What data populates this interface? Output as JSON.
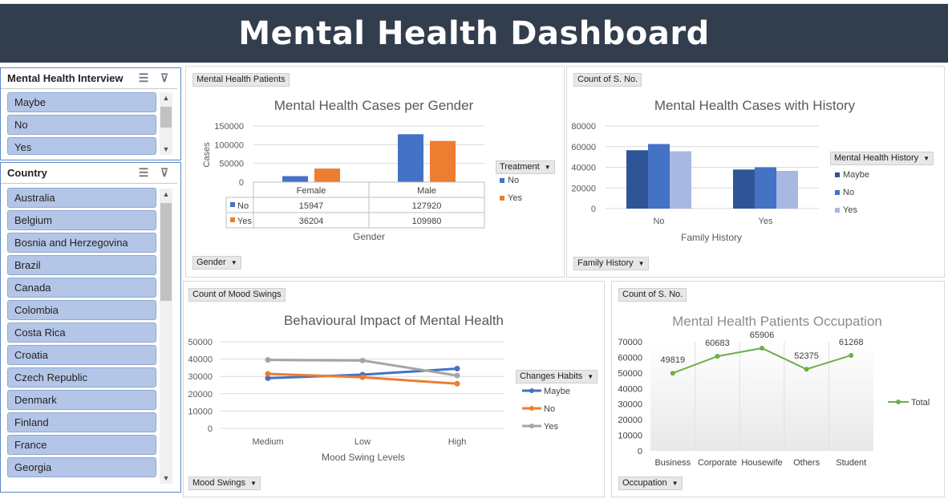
{
  "dashboard_title": "Mental Health Dashboard",
  "slicers": {
    "interview": {
      "title": "Mental Health Interview",
      "items": [
        "Maybe",
        "No",
        "Yes"
      ]
    },
    "country": {
      "title": "Country",
      "items": [
        "Australia",
        "Belgium",
        "Bosnia and Herzegovina",
        "Brazil",
        "Canada",
        "Colombia",
        "Costa Rica",
        "Croatia",
        "Czech Republic",
        "Denmark",
        "Finland",
        "France",
        "Georgia"
      ]
    }
  },
  "colors": {
    "blue": "#4472c4",
    "orange": "#ed7d31",
    "gray": "#a5a5a5",
    "green": "#70ad47",
    "dark_blue": "#2f5597",
    "light_blue": "#a9b8e0",
    "banner": "#323d4d"
  },
  "panels": {
    "gender": {
      "value_btn": "Mental Health Patients",
      "axis_btn": "Gender",
      "legend_btn": "Treatment"
    },
    "history": {
      "value_btn": "Count of S. No.",
      "axis_btn": "Family History",
      "legend_btn": "Mental Health History"
    },
    "mood": {
      "value_btn": "Count of Mood Swings",
      "axis_btn": "Mood Swings",
      "legend_btn": "Changes Habits"
    },
    "occupation": {
      "value_btn": "Count of S. No.",
      "axis_btn": "Occupation"
    }
  },
  "chart_data": [
    {
      "type": "bar",
      "title": "Mental Health Cases per Gender",
      "xlabel": "Gender",
      "ylabel": "Cases",
      "categories": [
        "Female",
        "Male"
      ],
      "series": [
        {
          "name": "No",
          "values": [
            15947,
            127920
          ]
        },
        {
          "name": "Yes",
          "values": [
            36204,
            109980
          ]
        }
      ],
      "ylim": [
        0,
        150000
      ],
      "yticks": [
        "150000",
        "100000",
        "50000",
        "0"
      ],
      "table": [
        [
          "15947",
          "127920"
        ],
        [
          "36204",
          "109980"
        ]
      ],
      "legend_position": "right"
    },
    {
      "type": "bar",
      "title": "Mental Health Cases with History",
      "xlabel": "Family History",
      "categories": [
        "No",
        "Yes"
      ],
      "series": [
        {
          "name": "Maybe",
          "values": [
            56500,
            37800
          ]
        },
        {
          "name": "No",
          "values": [
            62500,
            40000
          ]
        },
        {
          "name": "Yes",
          "values": [
            55500,
            36500
          ]
        }
      ],
      "ylim": [
        0,
        80000
      ],
      "yticks": [
        "80000",
        "60000",
        "40000",
        "20000",
        "0"
      ],
      "legend_position": "right"
    },
    {
      "type": "line",
      "title": "Behavioural Impact of Mental Health",
      "xlabel": "Mood Swing Levels",
      "categories": [
        "Medium",
        "Low",
        "High"
      ],
      "series": [
        {
          "name": "Maybe",
          "values": [
            29000,
            31000,
            34500
          ]
        },
        {
          "name": "No",
          "values": [
            31500,
            29500,
            25800
          ]
        },
        {
          "name": "Yes",
          "values": [
            39500,
            39200,
            30500
          ]
        }
      ],
      "ylim": [
        0,
        50000
      ],
      "yticks": [
        "50000",
        "40000",
        "30000",
        "20000",
        "10000",
        "0"
      ],
      "legend_position": "right"
    },
    {
      "type": "line",
      "title": "Mental Health Patients Occupation",
      "categories": [
        "Business",
        "Corporate",
        "Housewife",
        "Others",
        "Student"
      ],
      "series": [
        {
          "name": "Total",
          "values": [
            49819,
            60683,
            65906,
            52375,
            61268
          ]
        }
      ],
      "data_labels": [
        "49819",
        "60683",
        "65906",
        "52375",
        "61268"
      ],
      "ylim": [
        0,
        70000
      ],
      "yticks": [
        "70000",
        "60000",
        "50000",
        "40000",
        "30000",
        "20000",
        "10000",
        "0"
      ],
      "legend_position": "right"
    }
  ]
}
